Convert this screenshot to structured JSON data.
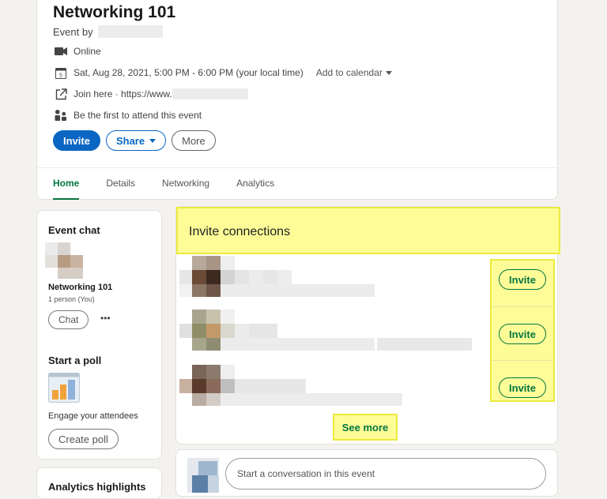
{
  "event": {
    "title": "Networking 101",
    "byline_prefix": "Event by",
    "location": "Online",
    "datetime": "Sat, Aug 28, 2021, 5:00 PM - 6:00 PM (your local time)",
    "add_to_calendar": "Add to calendar",
    "join_prefix": "Join here · https://www.",
    "attendees": "Be the first to attend this event"
  },
  "actions": {
    "invite": "Invite",
    "share": "Share",
    "more": "More"
  },
  "tabs": [
    {
      "label": "Home",
      "active": true
    },
    {
      "label": "Details",
      "active": false
    },
    {
      "label": "Networking",
      "active": false
    },
    {
      "label": "Analytics",
      "active": false
    }
  ],
  "sidebar": {
    "event_chat_heading": "Event chat",
    "chat_name": "Networking 101",
    "chat_members": "1 person (You)",
    "chat_button": "Chat",
    "more_dots": "•••",
    "poll_heading": "Start a poll",
    "poll_caption": "Engage your attendees",
    "create_poll": "Create poll",
    "analytics_heading": "Analytics highlights"
  },
  "invite_panel": {
    "heading": "Invite connections",
    "invite_label": "Invite",
    "see_more": "See more"
  },
  "conversation": {
    "placeholder": "Start a conversation in this event"
  },
  "colors": {
    "primary": "#0a66c2",
    "green": "#057642",
    "highlight": "#fefc97"
  }
}
